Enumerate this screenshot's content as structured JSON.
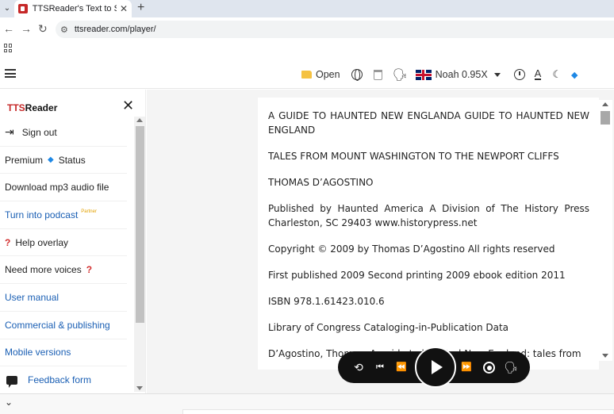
{
  "browser": {
    "tab_title": "TTSReader's Text to Spe",
    "url": "ttsreader.com/player/"
  },
  "toolbar": {
    "open_label": "Open",
    "voice_label": "Noah 0.95X"
  },
  "sidebar": {
    "brand_prefix": "TTS",
    "brand_suffix": "Reader",
    "items": {
      "sign_out": "Sign out",
      "premium": "Premium",
      "status": "Status",
      "download": "Download mp3 audio file",
      "podcast": "Turn into podcast",
      "partner": "Partner",
      "help": "Help overlay",
      "more_voices": "Need more voices",
      "manual": "User manual",
      "commercial": "Commercial & publishing",
      "mobile": "Mobile versions",
      "feedback": "Feedback form"
    }
  },
  "document": {
    "paragraphs": [
      "A GUIDE TO HAUNTED NEW ENGLANDA GUIDE TO HAUNTED NEW ENGLAND",
      "TALES FROM MOUNT WASHINGTON TO THE NEWPORT CLIFFS",
      "THOMAS D’AGOSTINO",
      "Published by Haunted America A Division of The History Press Charleston, SC 29403 www.historypress.net",
      "Copyright © 2009 by Thomas D’Agostino All rights reserved",
      "First published 2009 Second printing 2009 ebook edition 2011",
      "ISBN 978.1.61423.010.6",
      "Library of Congress Cataloging-in-Publication Data",
      "D’Agostino, Thomas. A guide to haunted New England: tales from"
    ]
  }
}
